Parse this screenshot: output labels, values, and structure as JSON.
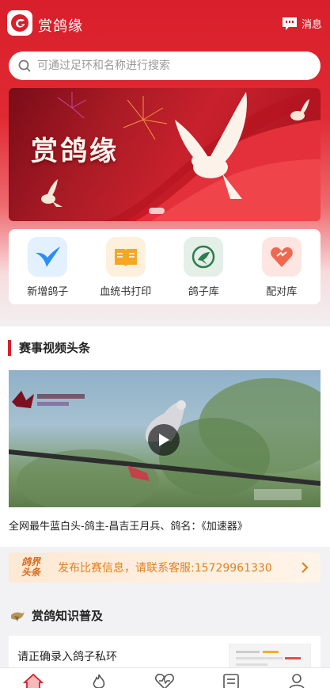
{
  "app": {
    "title": "赏鸽缘",
    "message_label": "消息"
  },
  "search": {
    "placeholder": "可通过足环和名称进行搜索"
  },
  "banner": {
    "title": "赏鸽缘"
  },
  "quick_actions": [
    {
      "label": "新增鸽子",
      "icon": "dove-icon",
      "color": "#2a8ef2"
    },
    {
      "label": "血统书打印",
      "icon": "book-icon",
      "color": "#f5a623"
    },
    {
      "label": "鸽子库",
      "icon": "pigeon-target-icon",
      "color": "#2e7d4f"
    },
    {
      "label": "配对库",
      "icon": "heart-icon",
      "color": "#f0684f"
    }
  ],
  "video_section": {
    "title": "赛事视频头条",
    "caption": "全网最牛蓝白头-鸽主-昌吉王月兵、鸽名：《加速器》"
  },
  "notice": {
    "tag_line1": "鸽界",
    "tag_line2": "头条",
    "text": "发布比赛信息，请联系客服:15729961330"
  },
  "knowledge": {
    "title": "赏鸽知识普及"
  },
  "article": {
    "title": "请正确录入鸽子私环"
  },
  "tabs": [
    "home-icon",
    "flame-icon",
    "heartbeat-icon",
    "news-icon",
    "user-icon"
  ],
  "colors": {
    "brand_red": "#d81f2b",
    "notice_orange": "#e08121"
  }
}
